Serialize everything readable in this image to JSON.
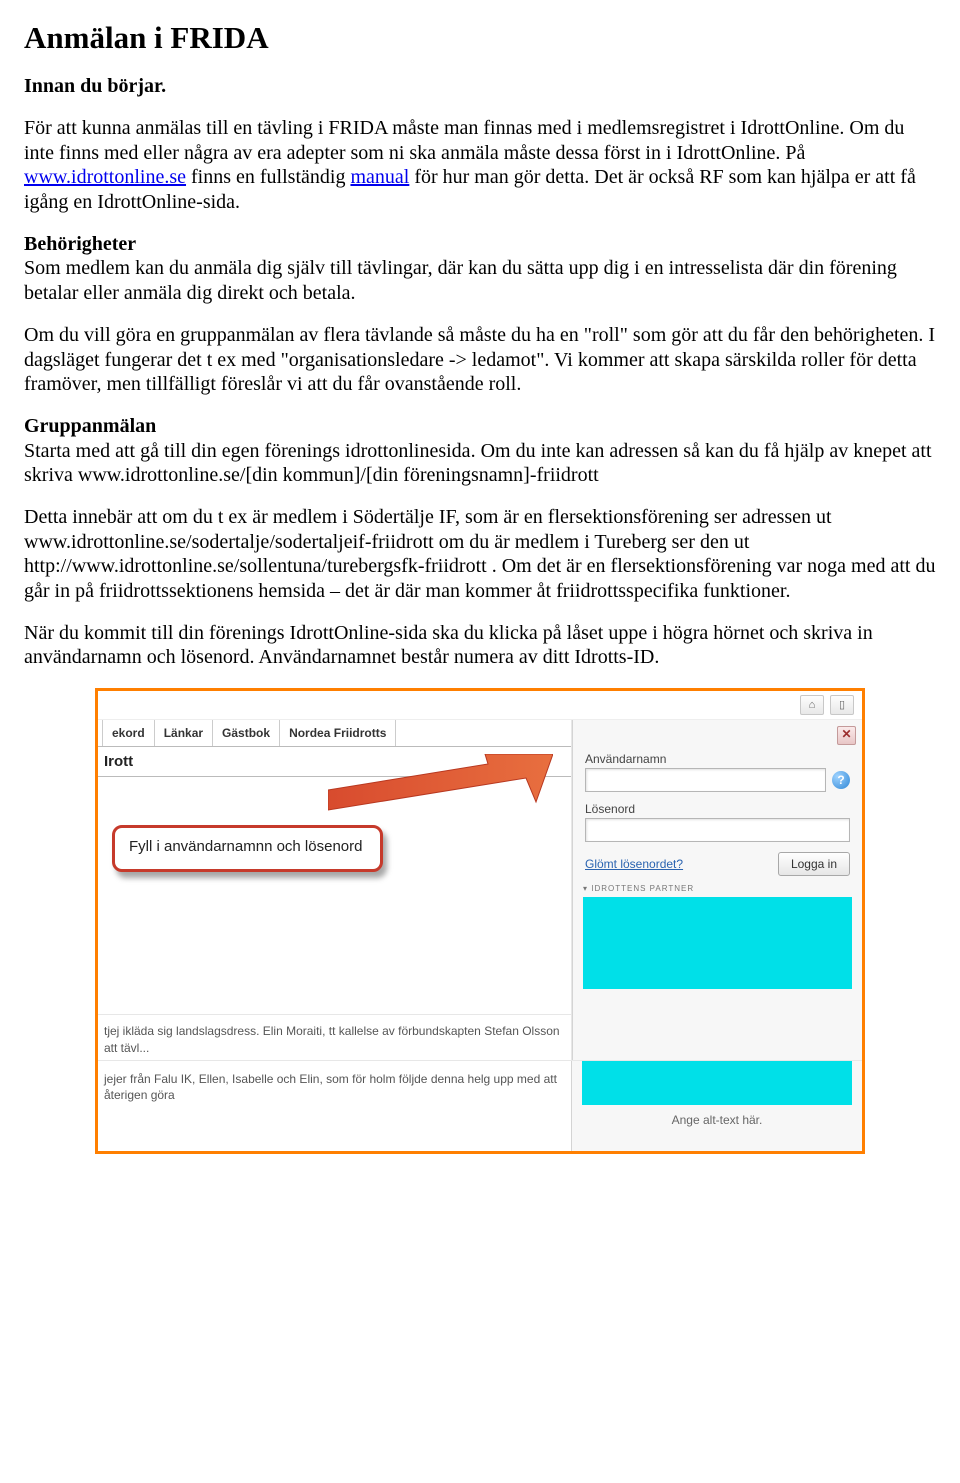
{
  "title": "Anmälan i FRIDA",
  "section_intro_heading": "Innan du börjar.",
  "p1a": "För att kunna anmälas till en tävling i FRIDA måste man finnas med i medlemsregistret i IdrottOnline. Om du inte finns med eller några av era adepter som ni ska anmäla måste dessa först in i IdrottOnline. På ",
  "p1_link": "www.idrottonline.se",
  "p1b": " finns en fullständig ",
  "p1_link2": "manual",
  "p1c": " för hur man gör detta. Det är också RF som kan hjälpa er att få igång en IdrottOnline-sida.",
  "behorigheter_heading": "Behörigheter",
  "p2": "Som medlem kan du anmäla dig själv till tävlingar, där kan du sätta upp dig i en intresselista där din förening betalar eller anmäla dig direkt och betala.",
  "p3": "Om du vill göra en gruppanmälan av flera tävlande så måste du ha en \"roll\" som gör att du får den behörigheten. I dagsläget fungerar det t ex med \"organisationsledare -> ledamot\". Vi kommer att skapa särskilda roller för detta framöver, men tillfälligt föreslår vi att du får ovanstående roll.",
  "grupp_heading": "Gruppanmälan",
  "p4": "Starta med att gå till din egen förenings idrottonlinesida. Om du inte kan adressen så kan du få hjälp av knepet att skriva www.idrottonline.se/[din kommun]/[din föreningsnamn]-friidrott",
  "p5": "Detta innebär att om du t ex är medlem i Södertälje IF, som är en flersektionsförening ser adressen ut www.idrottonline.se/sodertalje/sodertaljeif-friidrott om du är medlem i Tureberg ser den ut http://www.idrottonline.se/sollentuna/turebergsfk-friidrott . Om det är en flersektionsförening var noga med att du går in på friidrottssektionens hemsida – det är där man kommer åt friidrottsspecifika funktioner.",
  "p6": "När du kommit till din förenings IdrottOnline-sida ska du klicka på låset uppe i högra hörnet och skriva in användarnamn och lösenord. Användarnamnet består numera av ditt Idrotts-ID.",
  "shot": {
    "tabs": [
      "ekord",
      "Länkar",
      "Gästbok",
      "Nordea Friidrotts"
    ],
    "subhead": "Irott",
    "callout": "Fyll i användarnamnn och lösenord",
    "snippet1": "tjej ikläda sig landslagsdress. Elin Moraiti, tt kallelse av förbundskapten Stefan Olsson att tävl...",
    "snippet2": "jejer från Falu IK, Ellen, Isabelle och Elin, som för holm följde denna helg upp med att återigen göra",
    "login_user_label": "Användarnamn",
    "login_pass_label": "Lösenord",
    "forgot": "Glömt lösenordet?",
    "login_btn": "Logga in",
    "partner_hdr": "▾ IDROTTENS PARTNER",
    "alttext": "Ange alt-text här.",
    "close": "✕",
    "help": "?",
    "toolbar_icon": "⌂"
  }
}
